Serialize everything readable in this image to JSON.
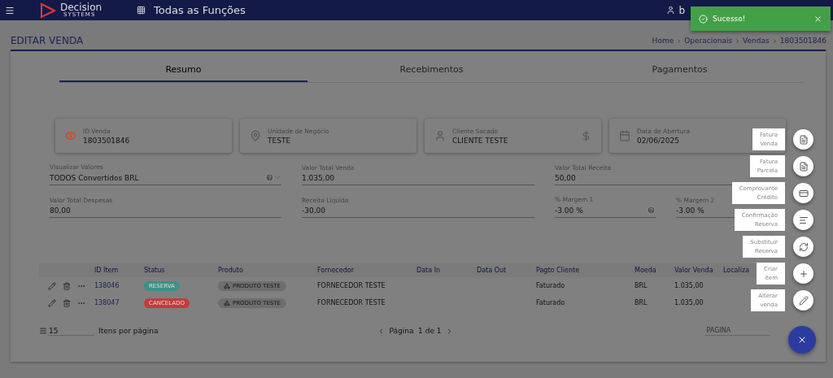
{
  "topbar": {
    "brand": "Decision",
    "brand_sub": "SYSTEMS",
    "menu_label": "Todas as Funções",
    "user": "b"
  },
  "toast": {
    "message": "Sucesso!"
  },
  "page": {
    "title": "EDITAR VENDA",
    "breadcrumb": [
      "Home",
      "Operacionais",
      "Vendas",
      "1803501846"
    ]
  },
  "tabs": [
    {
      "label": "Resumo",
      "selected": true
    },
    {
      "label": "Recebimentos",
      "selected": false
    },
    {
      "label": "Pagamentos",
      "selected": false
    }
  ],
  "info_cards": [
    {
      "kind": "view",
      "label": "ID Venda",
      "value": "1803501846"
    },
    {
      "kind": "location",
      "label": "Unidade de Negócio",
      "value": "TESTE"
    },
    {
      "kind": "person",
      "label": "Cliente Sacado",
      "value": "CLIENTE TESTE"
    },
    {
      "kind": "date",
      "label": "Data de Abertura",
      "value": "02/06/2025"
    }
  ],
  "field_rows": [
    [
      {
        "kind": "select",
        "label": "Visualizar Valores",
        "value": "TODOS Convertidos BRL"
      },
      {
        "kind": "text",
        "label": "Valor Total Venda",
        "value": "1.035,00"
      },
      {
        "kind": "text",
        "label": "Valor Total Receita",
        "value": "50,00"
      }
    ],
    [
      {
        "kind": "text",
        "label": "Valor Total Despesas",
        "value": "80,00"
      },
      {
        "kind": "text",
        "label": "Receita Líquida",
        "value": "-30,00"
      },
      {
        "kind": "help",
        "label": "% Margem 1",
        "value": "-3.00 %"
      },
      {
        "kind": "text",
        "label": "% Margem 2",
        "value": "-3.00 %"
      }
    ]
  ],
  "table": {
    "columns": [
      "ID Item",
      "Status",
      "Produto",
      "Fornecedor",
      "Data In",
      "Data Out",
      "Pagto Cliente",
      "Moeda",
      "Valor Venda",
      "Localiza"
    ],
    "rows": [
      {
        "id": "138046",
        "status": "RESERVA",
        "color": "#3f8f88",
        "product": "PRODUTO TESTE",
        "supplier": "FORNECEDOR TESTE",
        "payment": "Faturado",
        "currency": "BRL",
        "value": "1.035,00"
      },
      {
        "id": "138047",
        "status": "CANCELADO",
        "color": "#c43b3b",
        "product": "PRODUTO TESTE",
        "supplier": "FORNECEDOR TESTE",
        "payment": "Faturado",
        "currency": "BRL",
        "value": "1.035,00"
      }
    ]
  },
  "pagination": {
    "per_page": "15",
    "per_page_label": "Itens por página",
    "page_info": "Página  1 de 1",
    "page_placeholder": "PÁGINA"
  },
  "fab_actions": [
    {
      "kind": "invoice",
      "label": "Fatura\nVenda"
    },
    {
      "kind": "invoice",
      "label": "Fatura\nParcela"
    },
    {
      "kind": "card",
      "label": "Comprovante\nCrédito"
    },
    {
      "kind": "notes",
      "label": "Confirmação\nReserva"
    },
    {
      "kind": "swap",
      "label": "Substituir\nReserva"
    },
    {
      "kind": "add",
      "label": "Criar\nitem"
    },
    {
      "kind": "edit",
      "label": "Alterar\nvenda"
    }
  ]
}
